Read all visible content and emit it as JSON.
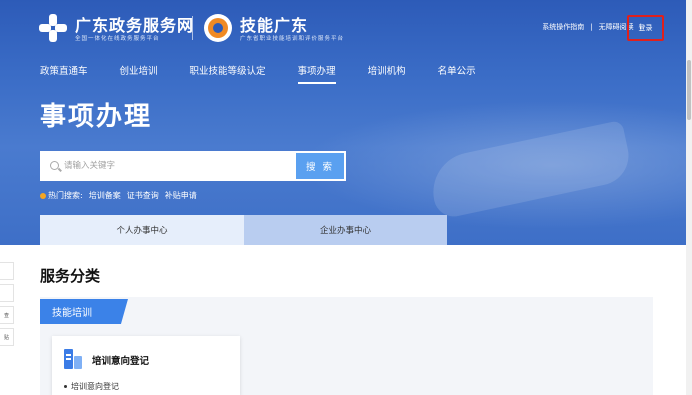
{
  "header": {
    "site1_title": "广东政务服务网",
    "site1_subtitle": "全国一体化在线政务服务平台",
    "site2_title": "技能广东",
    "site2_subtitle": "广东省职业技能培训和评价服务平台",
    "links": {
      "guide": "系统操作指南",
      "accessibility": "无障碍阅读",
      "login": "登录"
    },
    "login_highlight_color": "#e0201c"
  },
  "nav": {
    "items": [
      "政策直通车",
      "创业培训",
      "职业技能等级认定",
      "事项办理",
      "培训机构",
      "名单公示"
    ],
    "active": "事项办理"
  },
  "hero": {
    "title": "事项办理",
    "search_placeholder": "请输入关键字",
    "search_button": "搜 索",
    "hot_label": "热门搜索:",
    "hot_tags": [
      "培训备案",
      "证书查询",
      "补贴申请"
    ]
  },
  "tabs": {
    "personal": "个人办事中心",
    "company": "企业办事中心"
  },
  "side": {
    "items": [
      "",
      "",
      "查",
      "贴"
    ]
  },
  "main": {
    "section_title": "服务分类",
    "category": "技能培训",
    "card": {
      "title": "培训意向登记",
      "items": [
        "培训意向登记"
      ]
    }
  },
  "colors": {
    "hero_blue": "#3a6cc6",
    "accent": "#3b82e8",
    "search_button": "#5aa0f0"
  }
}
